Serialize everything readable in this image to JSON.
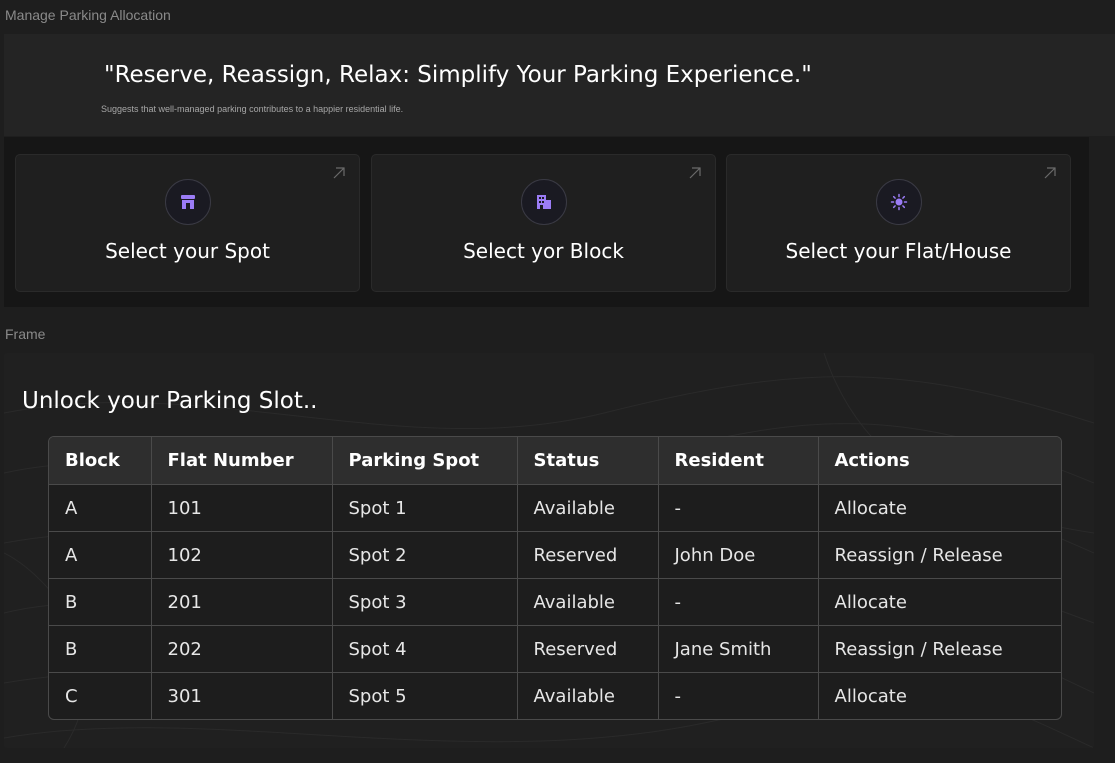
{
  "frames": {
    "top_label": "Manage Parking Allocation",
    "bottom_label": "Frame"
  },
  "hero": {
    "title": "\"Reserve, Reassign, Relax: Simplify Your Parking Experience.\"",
    "subtitle": "Suggests that well-managed parking contributes to a happier residential life."
  },
  "cards": [
    {
      "label": "Select your Spot",
      "icon": "store-icon"
    },
    {
      "label": "Select yor Block",
      "icon": "building-icon"
    },
    {
      "label": "Select your Flat/House",
      "icon": "sun-icon"
    }
  ],
  "colors": {
    "accent": "#9b7cf6",
    "background": "#1e1e1e"
  },
  "section": {
    "title": "Unlock your Parking Slot.."
  },
  "table": {
    "headers": [
      "Block",
      "Flat Number",
      "Parking Spot",
      "Status",
      "Resident",
      "Actions"
    ],
    "rows": [
      [
        "A",
        "101",
        "Spot 1",
        "Available",
        "-",
        "Allocate"
      ],
      [
        "A",
        "102",
        "Spot 2",
        "Reserved",
        "John Doe",
        "Reassign / Release"
      ],
      [
        "B",
        "201",
        "Spot 3",
        "Available",
        "-",
        "Allocate"
      ],
      [
        "B",
        "202",
        "Spot 4",
        "Reserved",
        "Jane Smith",
        "Reassign / Release"
      ],
      [
        "C",
        "301",
        "Spot 5",
        "Available",
        "-",
        "Allocate"
      ]
    ]
  }
}
